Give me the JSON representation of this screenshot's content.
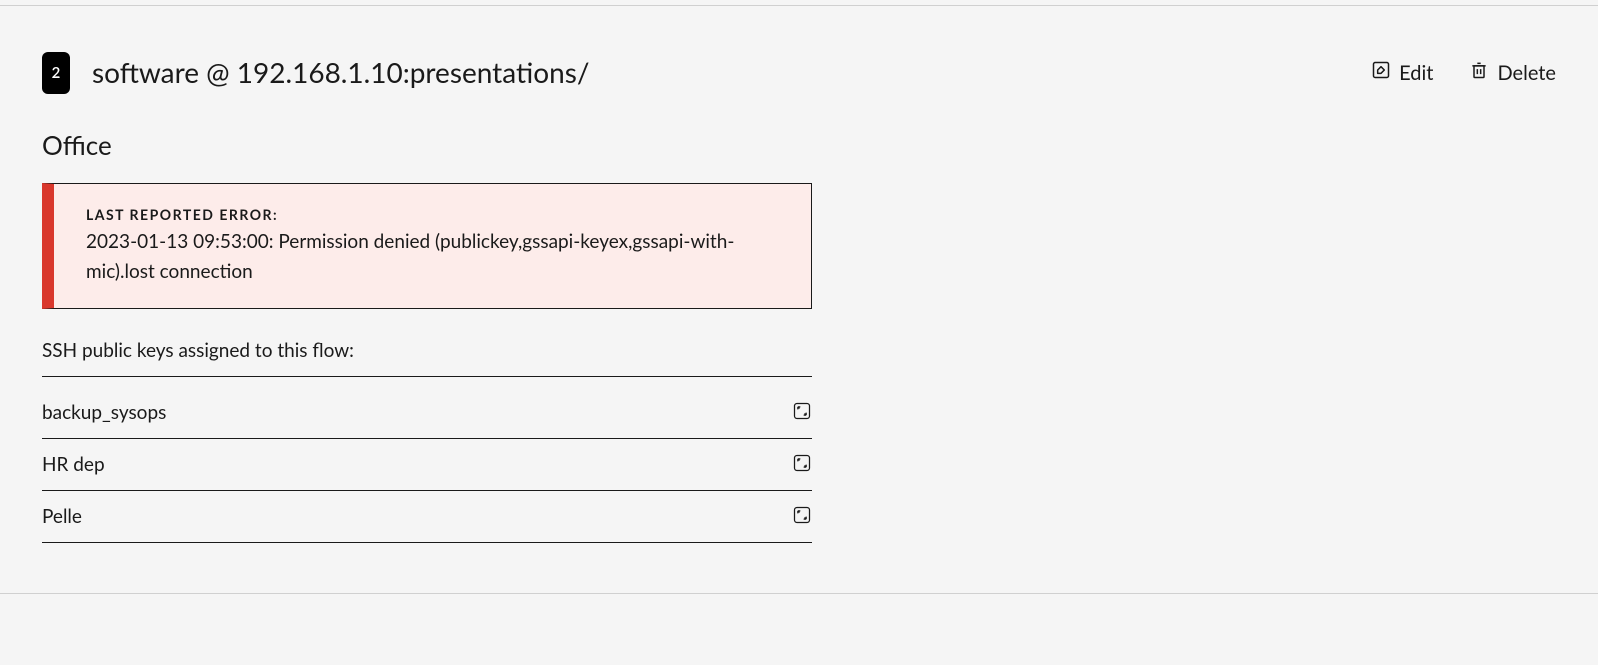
{
  "badge_number": "2",
  "title": "software @ 192.168.1.10:presentations/",
  "actions": {
    "edit_label": "Edit",
    "delete_label": "Delete"
  },
  "subtitle": "Office",
  "error": {
    "label": "LAST REPORTED ERROR:",
    "message": "2023-01-13 09:53:00: Permission denied (publickey,gssapi-keyex,gssapi-with-mic).lost connection"
  },
  "keys_section_label": "SSH public keys assigned to this flow:",
  "keys": [
    {
      "name": "backup_sysops"
    },
    {
      "name": "HR dep"
    },
    {
      "name": "Pelle"
    }
  ]
}
